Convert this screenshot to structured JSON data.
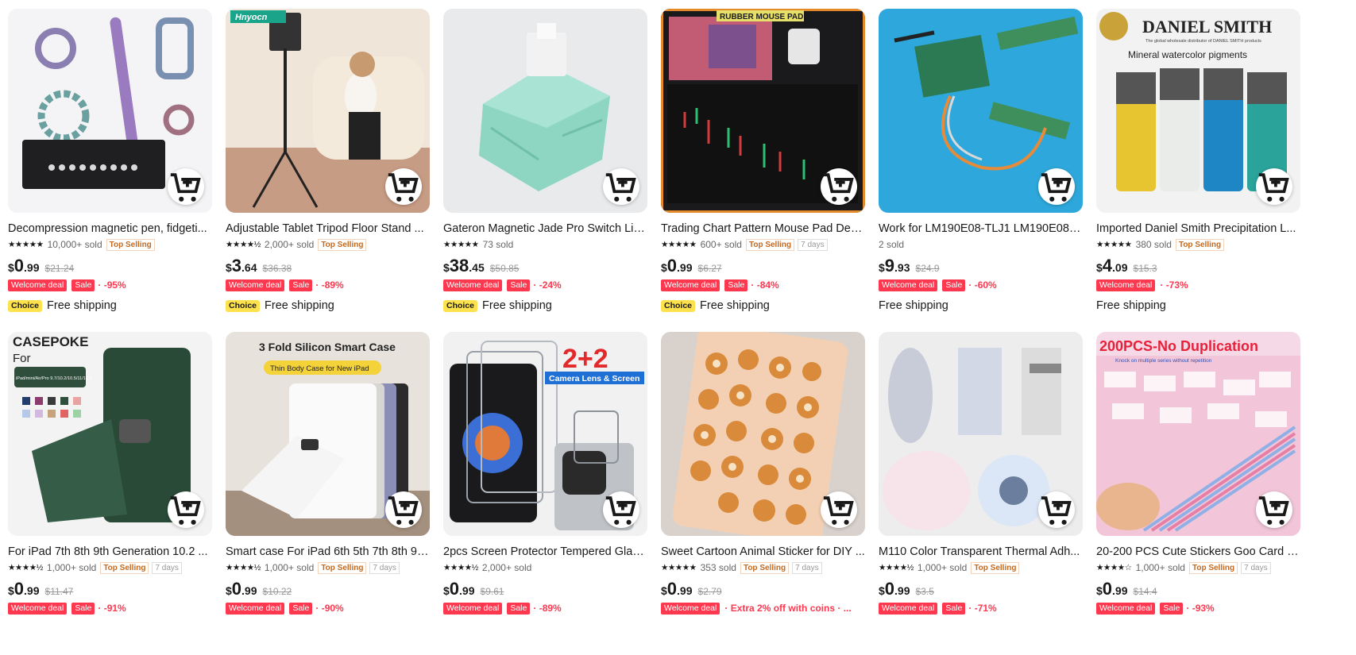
{
  "colors": {
    "deal_red": "#fd384f",
    "choice_yellow": "#fde24d",
    "top_selling_orange": "#c36a21"
  },
  "products": [
    {
      "title": "Decompression magnetic pen, fidgeti...",
      "stars": "★★★★★",
      "sold": "10,000+ sold",
      "top_selling": "Top Selling",
      "days": "",
      "price_currency": "$",
      "price_int": "0",
      "price_dec": ".99",
      "old_price": "$21.24",
      "welcome": "Welcome deal",
      "sale": "Sale",
      "discount": "-95%",
      "choice": "Choice",
      "shipping": "Free shipping",
      "icon": "cart-add-icon"
    },
    {
      "title": "Adjustable Tablet Tripod Floor Stand ...",
      "stars": "★★★★½",
      "sold": "2,000+ sold",
      "top_selling": "Top Selling",
      "days": "",
      "price_currency": "$",
      "price_int": "3",
      "price_dec": ".64",
      "old_price": "$36.38",
      "welcome": "Welcome deal",
      "sale": "Sale",
      "discount": "-89%",
      "choice": "Choice",
      "shipping": "Free shipping",
      "icon": "cart-add-icon"
    },
    {
      "title": "Gateron Magnetic Jade Pro Switch Lin...",
      "stars": "★★★★★",
      "sold": "73 sold",
      "top_selling": "",
      "days": "",
      "price_currency": "$",
      "price_int": "38",
      "price_dec": ".45",
      "old_price": "$50.85",
      "welcome": "Welcome deal",
      "sale": "Sale",
      "discount": "-24%",
      "choice": "Choice",
      "shipping": "Free shipping",
      "icon": "cart-add-icon"
    },
    {
      "title": "Trading Chart Pattern Mouse Pad Des...",
      "stars": "★★★★★",
      "sold": "600+ sold",
      "top_selling": "Top Selling",
      "days": "7 days",
      "price_currency": "$",
      "price_int": "0",
      "price_dec": ".99",
      "old_price": "$6.27",
      "welcome": "Welcome deal",
      "sale": "Sale",
      "discount": "-84%",
      "choice": "Choice",
      "shipping": "Free shipping",
      "icon": "cart-add-icon"
    },
    {
      "title": "Work for LM190E08-TLJ1 LM190E08-T...",
      "stars": "",
      "sold": "2 sold",
      "top_selling": "",
      "days": "",
      "price_currency": "$",
      "price_int": "9",
      "price_dec": ".93",
      "old_price": "$24.9",
      "welcome": "Welcome deal",
      "sale": "Sale",
      "discount": "-60%",
      "choice": "",
      "shipping": "Free shipping",
      "icon": "cart-add-icon"
    },
    {
      "title": "Imported Daniel Smith Precipitation L...",
      "stars": "★★★★★",
      "sold": "380 sold",
      "top_selling": "Top Selling",
      "days": "",
      "price_currency": "$",
      "price_int": "4",
      "price_dec": ".09",
      "old_price": "$15.3",
      "welcome": "Welcome deal",
      "sale": "",
      "discount": "-73%",
      "choice": "",
      "shipping": "Free shipping",
      "icon": "cart-add-icon"
    },
    {
      "title": "For iPad 7th 8th 9th Generation 10.2 ...",
      "stars": "★★★★½",
      "sold": "1,000+ sold",
      "top_selling": "Top Selling",
      "days": "7 days",
      "price_currency": "$",
      "price_int": "0",
      "price_dec": ".99",
      "old_price": "$11.47",
      "welcome": "Welcome deal",
      "sale": "Sale",
      "discount": "-91%",
      "choice": "",
      "shipping": "",
      "icon": "cart-add-icon"
    },
    {
      "title": "Smart case For iPad 6th 5th 7th 8th 9t...",
      "stars": "★★★★½",
      "sold": "1,000+ sold",
      "top_selling": "Top Selling",
      "days": "7 days",
      "price_currency": "$",
      "price_int": "0",
      "price_dec": ".99",
      "old_price": "$10.22",
      "welcome": "Welcome deal",
      "sale": "Sale",
      "discount": "-90%",
      "choice": "",
      "shipping": "",
      "icon": "cart-add-icon"
    },
    {
      "title": "2pcs Screen Protector Tempered Glas...",
      "stars": "★★★★½",
      "sold": "2,000+ sold",
      "top_selling": "",
      "days": "",
      "price_currency": "$",
      "price_int": "0",
      "price_dec": ".99",
      "old_price": "$9.61",
      "welcome": "Welcome deal",
      "sale": "Sale",
      "discount": "-89%",
      "choice": "",
      "shipping": "",
      "icon": "cart-add-icon"
    },
    {
      "title": "Sweet Cartoon Animal Sticker for DIY ...",
      "stars": "★★★★★",
      "sold": "353 sold",
      "top_selling": "Top Selling",
      "days": "7 days",
      "price_currency": "$",
      "price_int": "0",
      "price_dec": ".99",
      "old_price": "$2.79",
      "welcome": "Welcome deal",
      "sale": "",
      "discount": "Extra 2% off with coins · ...",
      "choice": "",
      "shipping": "",
      "icon": "cart-add-icon"
    },
    {
      "title": "M110 Color Transparent Thermal Adh...",
      "stars": "★★★★½",
      "sold": "1,000+ sold",
      "top_selling": "Top Selling",
      "days": "",
      "price_currency": "$",
      "price_int": "0",
      "price_dec": ".99",
      "old_price": "$3.5",
      "welcome": "Welcome deal",
      "sale": "Sale",
      "discount": "-71%",
      "choice": "",
      "shipping": "",
      "icon": "cart-add-icon"
    },
    {
      "title": "20-200 PCS Cute Stickers Goo Card Ka...",
      "stars": "★★★★☆",
      "sold": "1,000+ sold",
      "top_selling": "Top Selling",
      "days": "7 days",
      "price_currency": "$",
      "price_int": "0",
      "price_dec": ".99",
      "old_price": "$14.4",
      "welcome": "Welcome deal",
      "sale": "Sale",
      "discount": "-93%",
      "choice": "",
      "shipping": "",
      "icon": "cart-add-icon"
    }
  ],
  "image_text": {
    "p1": "Hnyocn",
    "p3": "RUBBER MOUSE PAD",
    "p5_brand": "DANIEL SMITH",
    "p5_sub": "The global wholesale distributor of DANIEL SMITH products",
    "p5_line": "Mineral watercolor pigments",
    "p6_brand": "CASEPOKE",
    "p6_for": "For",
    "p6_models": "iPad/mini/Air/Pro 9.7/10.2/10.5/11/12.9",
    "p7_head": "3 Fold Silicon Smart Case",
    "p7_pill": "Thin Body Case for New iPad",
    "p8_big": "2+2",
    "p8_sub": "Camera Lens & Screen",
    "p11_head": "200PCS-No Duplication",
    "p11_sub": "Knock on multiple series without repetition"
  }
}
